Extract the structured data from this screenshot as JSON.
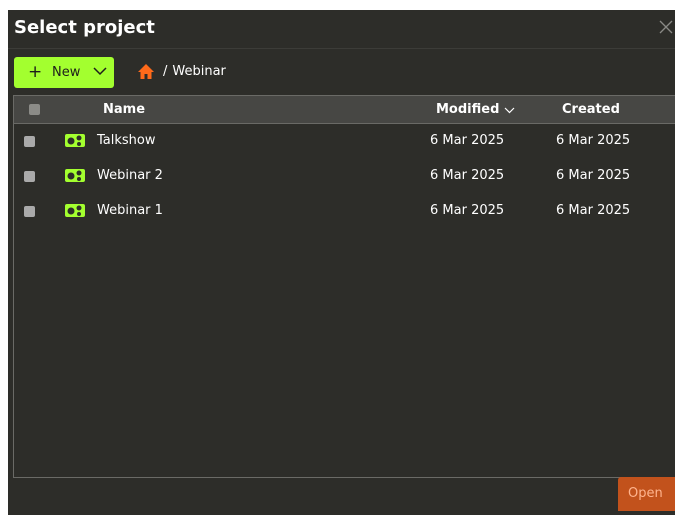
{
  "dialog": {
    "title": "Select project",
    "close_icon": "close-icon"
  },
  "toolbar": {
    "new_label": "New",
    "plus_glyph": "+",
    "breadcrumb": {
      "home_icon": "home-icon",
      "separator": "/",
      "current": "Webinar",
      "home_color": "#ff6a1a"
    }
  },
  "table": {
    "headers": {
      "name": "Name",
      "modified": "Modified",
      "created": "Created"
    },
    "sort": {
      "column": "modified",
      "direction": "descending"
    },
    "rows": [
      {
        "name": "Talkshow",
        "modified": "6 Mar 2025",
        "created": "6 Mar 2025",
        "icon": "project-icon"
      },
      {
        "name": "Webinar 2",
        "modified": "6 Mar 2025",
        "created": "6 Mar 2025",
        "icon": "project-icon"
      },
      {
        "name": "Webinar 1",
        "modified": "6 Mar 2025",
        "created": "6 Mar 2025",
        "icon": "project-icon"
      }
    ]
  },
  "footer": {
    "open_label": "Open"
  },
  "colors": {
    "accent": "#a3ff2f",
    "background": "#2d2d29",
    "header_bg": "#474744",
    "open_button": "#c2521c"
  }
}
